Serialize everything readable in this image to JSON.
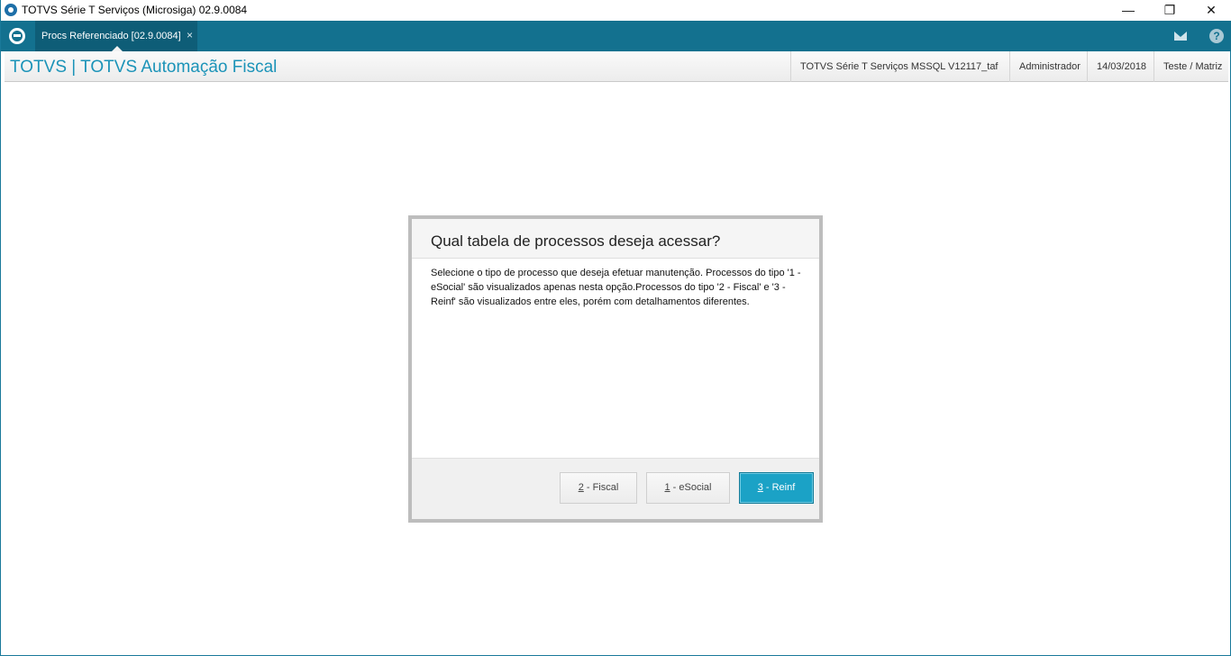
{
  "window": {
    "title": "TOTVS Série T Serviços (Microsiga) 02.9.0084",
    "controls": {
      "minimize": "—",
      "restore": "❐",
      "close": "✕"
    }
  },
  "tabbar": {
    "logo_icon": "totvs-logo-icon",
    "tabs": [
      {
        "label": "Procs Referenciado [02.9.0084]",
        "close": "×"
      }
    ],
    "icons": {
      "mail": "mail-icon",
      "help": "?"
    }
  },
  "header": {
    "app_title": "TOTVS | TOTVS Automação Fiscal",
    "environment": "TOTVS Série T Serviços MSSQL V12117_taf",
    "user": "Administrador",
    "date": "14/03/2018",
    "branch": "Teste / Matriz"
  },
  "dialog": {
    "title": "Qual tabela de processos deseja acessar?",
    "message": "Selecione o tipo de processo que deseja efetuar manutenção. Processos do tipo '1 - eSocial' são visualizados apenas nesta opção.Processos do tipo '2 - Fiscal' e '3 - Reinf' são visualizados entre eles, porém com detalhamentos diferentes.",
    "buttons": {
      "fiscal": {
        "key": "2",
        "label": " - Fiscal"
      },
      "esocial": {
        "key": "1",
        "label": " - eSocial"
      },
      "reinf": {
        "key": "3",
        "label": " - Reinf"
      }
    }
  },
  "colors": {
    "tabbar": "#13718f",
    "accent": "#1b93b8",
    "primary_button": "#1ba2c6"
  }
}
